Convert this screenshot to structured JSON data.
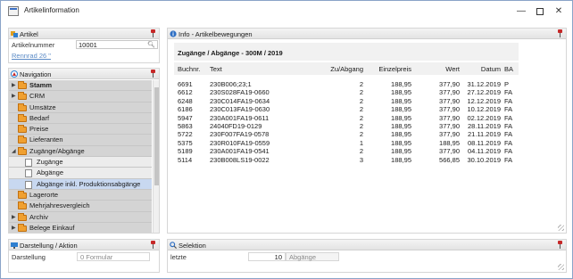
{
  "window": {
    "title": "Artikelinformation"
  },
  "artikel": {
    "header": "Artikel",
    "field_label": "Artikelnummer",
    "field_value": "10001",
    "link_text": "Rennrad 26 \""
  },
  "navigation": {
    "header": "Navigation",
    "items": [
      {
        "label": "Stamm",
        "type": "folder",
        "arrow": "▶",
        "bold": true
      },
      {
        "label": "CRM",
        "type": "folder",
        "arrow": "▶"
      },
      {
        "label": "Umsätze",
        "type": "folder",
        "arrow": ""
      },
      {
        "label": "Bedarf",
        "type": "folder",
        "arrow": ""
      },
      {
        "label": "Preise",
        "type": "folder",
        "arrow": ""
      },
      {
        "label": "Lieferanten",
        "type": "folder",
        "arrow": ""
      },
      {
        "label": "Zugänge/Abgänge",
        "type": "folder",
        "arrow": "◢"
      },
      {
        "label": "Zugänge",
        "type": "doc",
        "sub": true
      },
      {
        "label": "Abgänge",
        "type": "doc",
        "sub": true
      },
      {
        "label": "Abgänge inkl. Produktionsabgänge",
        "type": "doc",
        "sub": true,
        "selected": true
      },
      {
        "label": "Lagerorte",
        "type": "folder",
        "arrow": ""
      },
      {
        "label": "Mehrjahresvergleich",
        "type": "folder",
        "arrow": ""
      },
      {
        "label": "Archiv",
        "type": "folder",
        "arrow": "▶"
      },
      {
        "label": "Belege Einkauf",
        "type": "folder",
        "arrow": "▶"
      }
    ]
  },
  "darstellung": {
    "header": "Darstellung / Aktion",
    "label": "Darstellung",
    "value": "0 Formular"
  },
  "info": {
    "header": "Info - Artikelbewegungen",
    "title": "Zugänge / Abgänge - 300M / 2019",
    "columns": [
      "Buchnr.",
      "Text",
      "Zu/Abgang",
      "Einzelpreis",
      "Wert",
      "Datum",
      "BA"
    ],
    "rows": [
      [
        "6691",
        "230B006;23;1",
        "2",
        "188,95",
        "377,90",
        "31.12.2019",
        "P"
      ],
      [
        "6612",
        "230S028FA19-0660",
        "2",
        "188,95",
        "377,90",
        "27.12.2019",
        "FA"
      ],
      [
        "6248",
        "230C014FA19-0634",
        "2",
        "188,95",
        "377,90",
        "12.12.2019",
        "FA"
      ],
      [
        "6186",
        "230C013FA19-0630",
        "2",
        "188,95",
        "377,90",
        "10.12.2019",
        "FA"
      ],
      [
        "5947",
        "230A001FA19-0611",
        "2",
        "188,95",
        "377,90",
        "02.12.2019",
        "FA"
      ],
      [
        "5863",
        "24040FD19-0129",
        "2",
        "188,95",
        "377,90",
        "28.11.2019",
        "FA"
      ],
      [
        "5722",
        "230F007FA19-0578",
        "2",
        "188,95",
        "377,90",
        "21.11.2019",
        "FA"
      ],
      [
        "5375",
        "230R010FA19-0559",
        "1",
        "188,95",
        "188,95",
        "08.11.2019",
        "FA"
      ],
      [
        "5189",
        "230A001FA19-0541",
        "2",
        "188,95",
        "377,90",
        "04.11.2019",
        "FA"
      ],
      [
        "5114",
        "230B008LS19-0022",
        "3",
        "188,95",
        "566,85",
        "30.10.2019",
        "FA"
      ]
    ]
  },
  "selektion": {
    "header": "Selektion",
    "label": "letzte",
    "value": "10",
    "unit": "Abgänge"
  }
}
